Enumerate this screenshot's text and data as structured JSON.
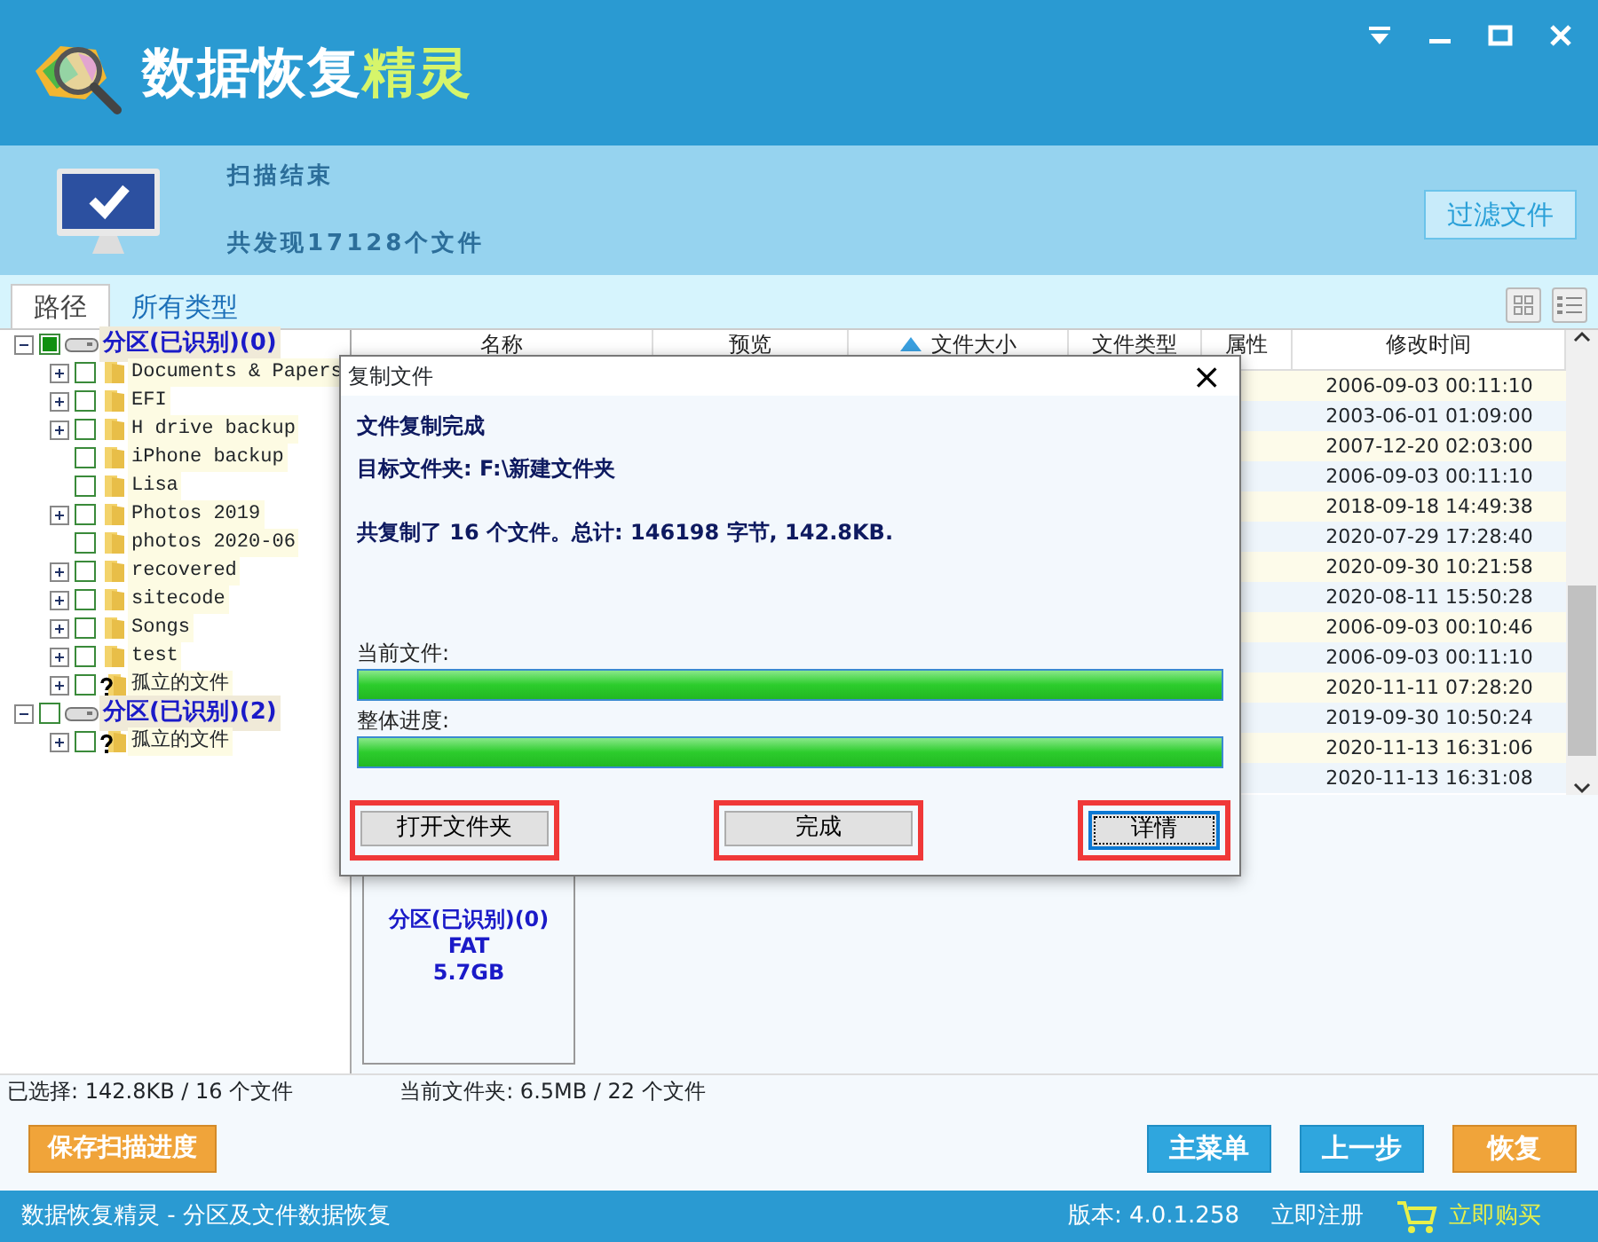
{
  "window": {
    "title_main": "数据恢复",
    "title_accent": "精灵"
  },
  "scan": {
    "status": "扫描结束",
    "found": "共发现17128个文件",
    "filter_button": "过滤文件"
  },
  "tabs": [
    {
      "label": "路径",
      "selected": true
    },
    {
      "label": "所有类型",
      "selected": false
    }
  ],
  "tree": [
    {
      "label": "分区(已识别)(0)",
      "kind": "partition",
      "checked": true,
      "expanded": true,
      "children": [
        {
          "label": "Documents & Papers",
          "kind": "folder",
          "checked": false,
          "has_children": true
        },
        {
          "label": "EFI",
          "kind": "folder",
          "checked": false,
          "has_children": true
        },
        {
          "label": "H drive backup",
          "kind": "folder",
          "checked": false,
          "has_children": true
        },
        {
          "label": "iPhone backup",
          "kind": "folder",
          "checked": false,
          "has_children": false
        },
        {
          "label": "Lisa",
          "kind": "folder",
          "checked": false,
          "has_children": false
        },
        {
          "label": "Photos 2019",
          "kind": "folder",
          "checked": false,
          "has_children": true
        },
        {
          "label": "photos 2020-06",
          "kind": "folder",
          "checked": false,
          "has_children": false
        },
        {
          "label": "recovered",
          "kind": "folder",
          "checked": false,
          "has_children": true
        },
        {
          "label": "sitecode",
          "kind": "folder",
          "checked": false,
          "has_children": true
        },
        {
          "label": "Songs",
          "kind": "folder",
          "checked": false,
          "has_children": true
        },
        {
          "label": "test",
          "kind": "folder",
          "checked": false,
          "has_children": true
        },
        {
          "label": "孤立的文件",
          "kind": "orphan",
          "checked": false,
          "has_children": true
        }
      ]
    },
    {
      "label": "分区(已识别)(2)",
      "kind": "partition",
      "checked": false,
      "expanded": true,
      "children": [
        {
          "label": "孤立的文件",
          "kind": "orphan",
          "checked": false,
          "has_children": true
        }
      ]
    }
  ],
  "table": {
    "columns": [
      {
        "label": "名称",
        "sorted": false
      },
      {
        "label": "预览",
        "sorted": false
      },
      {
        "label": "文件大小",
        "sorted": true
      },
      {
        "label": "文件类型",
        "sorted": false
      },
      {
        "label": "属性",
        "sorted": false
      },
      {
        "label": "修改时间",
        "sorted": false
      }
    ],
    "rows": [
      {
        "modified": "2006-09-03  00:11:10"
      },
      {
        "modified": "2003-06-01  01:09:00"
      },
      {
        "modified": "2007-12-20  02:03:00"
      },
      {
        "modified": "2006-09-03  00:11:10"
      },
      {
        "modified": "2018-09-18  14:49:38"
      },
      {
        "modified": "2020-07-29  17:28:40"
      },
      {
        "modified": "2020-09-30  10:21:58"
      },
      {
        "modified": "2020-08-11  15:50:28"
      },
      {
        "modified": "2006-09-03  00:10:46"
      },
      {
        "modified": "2006-09-03  00:11:10"
      },
      {
        "modified": "2020-11-11  07:28:20"
      },
      {
        "modified": "2019-09-30  10:50:24"
      },
      {
        "modified": "2020-11-13  16:31:06"
      },
      {
        "modified": "2020-11-13  16:31:08"
      }
    ]
  },
  "partition_card": {
    "name": "分区(已识别)(0)",
    "filesystem": "FAT",
    "size": "5.7GB"
  },
  "status": {
    "selected": "已选择: 142.8KB / 16 个文件",
    "current_folder": "当前文件夹: 6.5MB / 22 个文件"
  },
  "actions": [
    {
      "label": "保存扫描进度",
      "kind": "orange"
    },
    {
      "label": "主菜单",
      "kind": "blue"
    },
    {
      "label": "上一步",
      "kind": "blue"
    },
    {
      "label": "恢复",
      "kind": "orange"
    }
  ],
  "footer": {
    "product": "数据恢复精灵 - 分区及文件数据恢复",
    "version": "版本: 4.0.1.258",
    "register": "立即注册",
    "buy": "立即购买"
  },
  "dialog": {
    "title": "复制文件",
    "close": "×",
    "heading": "文件复制完成",
    "target": "目标文件夹: F:\\新建文件夹",
    "summary": "共复制了 16 个文件。总计: 146198 字节, 142.8KB.",
    "progress": [
      {
        "label": "当前文件:",
        "level": 1
      },
      {
        "label": "整体进度:",
        "level": 1
      }
    ],
    "buttons": [
      {
        "label": "打开文件夹",
        "highlighted": true,
        "focused": false
      },
      {
        "label": "完成",
        "highlighted": true,
        "focused": false
      },
      {
        "label": "详情",
        "highlighted": true,
        "focused": true
      }
    ]
  }
}
